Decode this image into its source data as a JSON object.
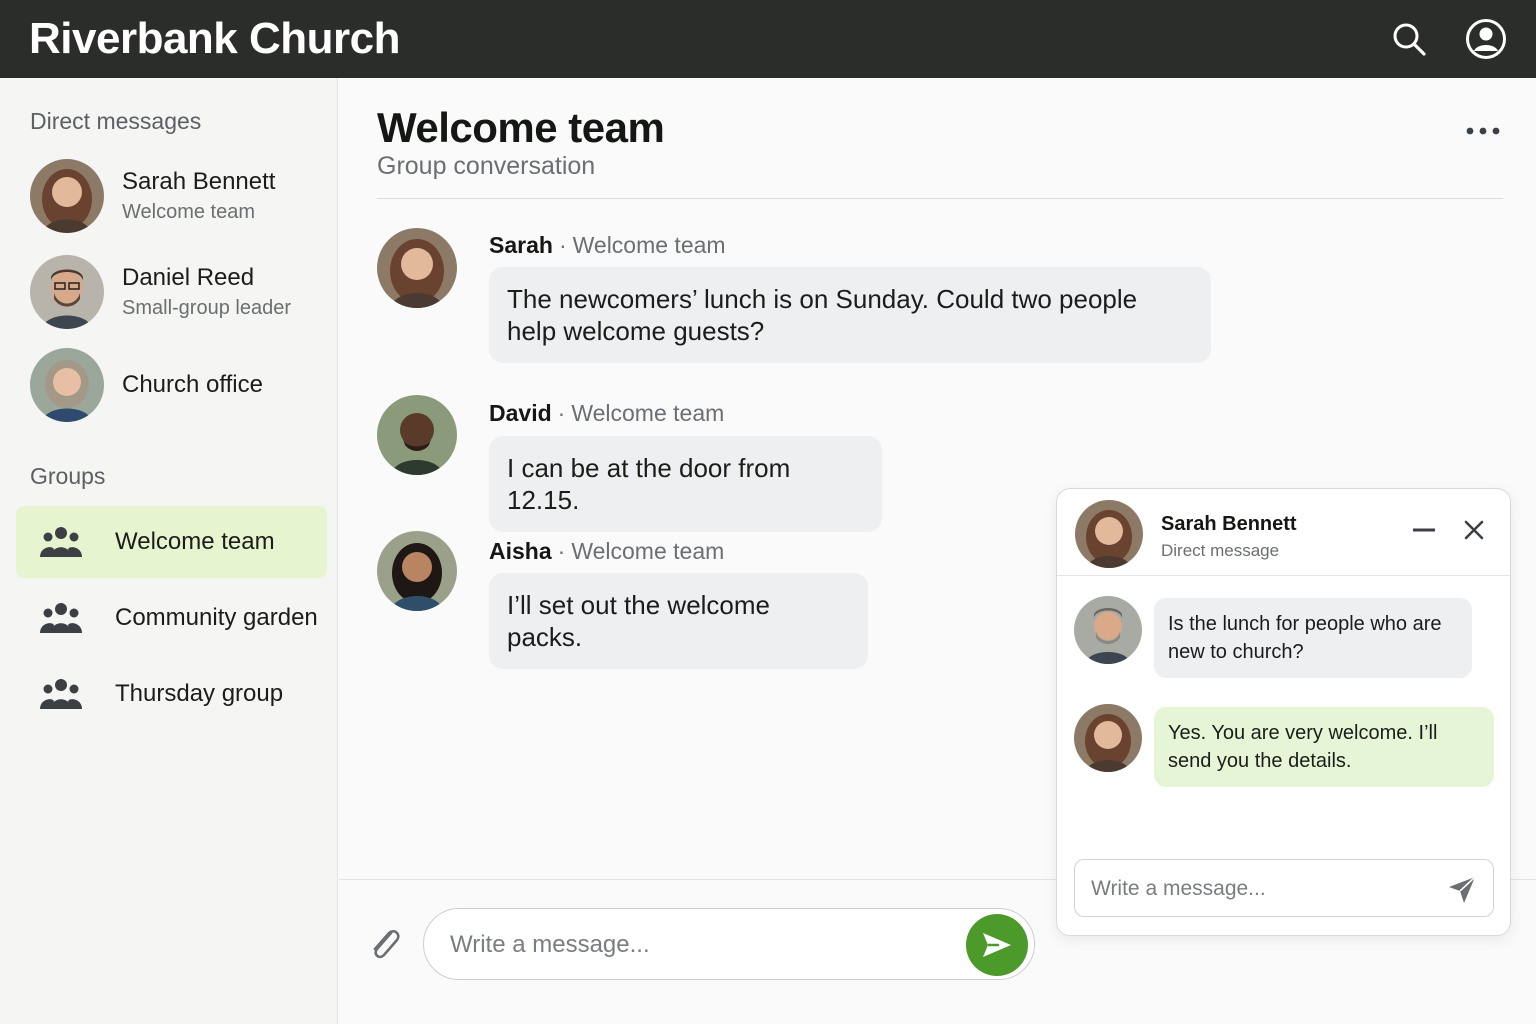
{
  "app": {
    "title": "Riverbank Church"
  },
  "sidebar": {
    "dm_heading": "Direct messages",
    "direct_messages": [
      {
        "name": "Sarah Bennett",
        "subtitle": "Welcome team"
      },
      {
        "name": "Daniel Reed",
        "subtitle": "Small-group leader"
      },
      {
        "name": "Church office",
        "subtitle": ""
      }
    ],
    "groups_heading": "Groups",
    "groups": [
      {
        "label": "Welcome team",
        "active": true
      },
      {
        "label": "Community garden",
        "active": false
      },
      {
        "label": "Thursday group",
        "active": false
      }
    ]
  },
  "conversation": {
    "title": "Welcome team",
    "subtitle": "Group conversation",
    "separator": "·",
    "messages": [
      {
        "sender": "Sarah",
        "group": "Welcome team",
        "text": "The newcomers’ lunch is on Sunday. Could two people help welcome guests?"
      },
      {
        "sender": "David",
        "group": "Welcome team",
        "text": "I can be at the door from 12.15."
      },
      {
        "sender": "Aisha",
        "group": "Welcome team",
        "text": "I’ll set out the welcome packs."
      }
    ],
    "composer_placeholder": "Write a message..."
  },
  "popup": {
    "name": "Sarah Bennett",
    "subtitle": "Direct message",
    "messages": [
      {
        "from": "other",
        "text": "Is the lunch for people who are new to church?"
      },
      {
        "from": "self",
        "text": "Yes. You are very welcome. I’ll send you the details."
      }
    ],
    "composer_placeholder": "Write a message..."
  },
  "colors": {
    "topbar": "#2a2d29",
    "active_group": "#e6f5cf",
    "send_button": "#4c9a2a",
    "self_bubble": "#e6f5d6",
    "other_bubble": "#eeeff1"
  },
  "icons": {
    "search": "search-icon",
    "profile": "user-circle-icon",
    "group": "people-icon",
    "more": "more-dots-icon",
    "attach": "paperclip-icon",
    "send": "send-icon",
    "minimize": "minimize-icon",
    "close": "close-icon"
  }
}
